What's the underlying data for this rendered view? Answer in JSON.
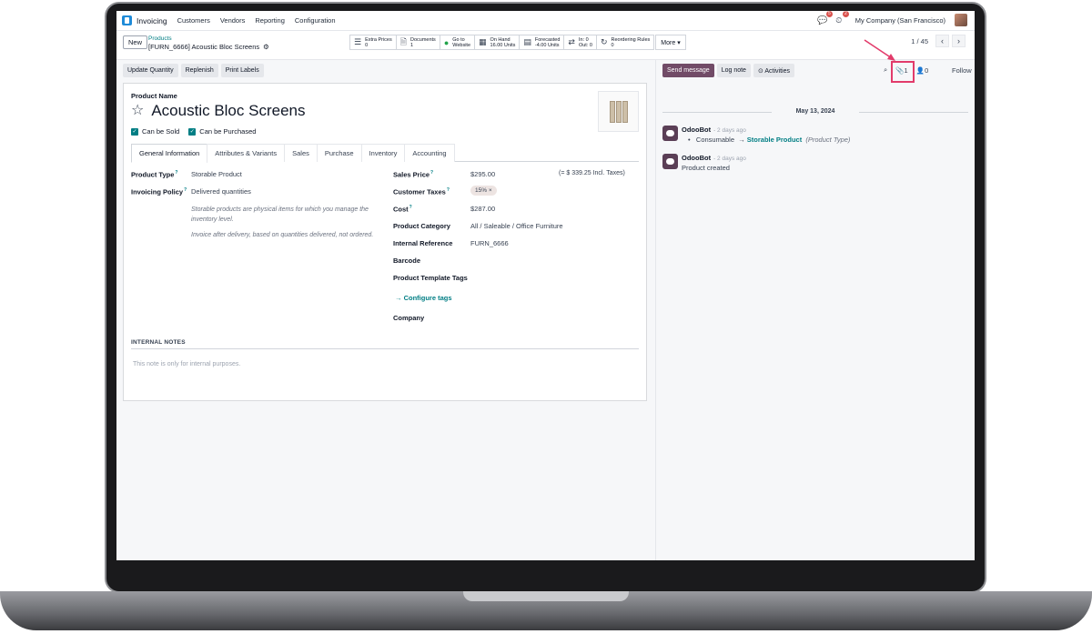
{
  "nav": {
    "app_name": "Invoicing",
    "menu": [
      "Customers",
      "Vendors",
      "Reporting",
      "Configuration"
    ],
    "chat_badge": "5",
    "activity_badge": "2",
    "company": "My Company (San Francisco)"
  },
  "control": {
    "new_label": "New",
    "breadcrumb": "Products",
    "record": "[FURN_6666] Acoustic Bloc Screens",
    "smart_buttons": [
      {
        "icon": "list-icon",
        "line1": "Extra Prices",
        "line2": "0"
      },
      {
        "icon": "document-icon",
        "line1": "Documents",
        "line2": "1"
      },
      {
        "icon": "globe-icon",
        "line1": "Go to",
        "line2": "Website"
      },
      {
        "icon": "cubes-icon",
        "line1": "On Hand",
        "line2": "16.00 Units"
      },
      {
        "icon": "chart-icon",
        "line1": "Forecasted",
        "line2": "-4.00 Units"
      },
      {
        "icon": "exchange-icon",
        "line1": "In: 0",
        "line2": "Out: 0"
      },
      {
        "icon": "refresh-icon",
        "line1": "Reordering Rules",
        "line2": "0"
      }
    ],
    "more_label": "More ▾",
    "pager": "1 / 45"
  },
  "actions": [
    "Update Quantity",
    "Replenish",
    "Print Labels"
  ],
  "form": {
    "product_name_label": "Product Name",
    "title": "Acoustic Bloc Screens",
    "can_be_sold": "Can be Sold",
    "can_be_purchased": "Can be Purchased",
    "tabs": [
      "General Information",
      "Attributes & Variants",
      "Sales",
      "Purchase",
      "Inventory",
      "Accounting"
    ],
    "left": {
      "product_type_label": "Product Type",
      "product_type": "Storable Product",
      "invoicing_policy_label": "Invoicing Policy",
      "invoicing_policy": "Delivered quantities",
      "help1": "Storable products are physical items for which you manage the inventory level.",
      "help2": "Invoice after delivery, based on quantities delivered, not ordered."
    },
    "right": {
      "sales_price_label": "Sales Price",
      "sales_price": "$295.00",
      "incl_taxes": "(= $ 339.25 Incl. Taxes)",
      "customer_taxes_label": "Customer Taxes",
      "customer_tax_tag": "15% ×",
      "cost_label": "Cost",
      "cost": "$287.00",
      "category_label": "Product Category",
      "category": "All / Saleable / Office Furniture",
      "internal_ref_label": "Internal Reference",
      "internal_ref": "FURN_6666",
      "barcode_label": "Barcode",
      "template_tags_label": "Product Template Tags",
      "configure_tags": "→  Configure tags",
      "company_label": "Company"
    },
    "notes_header": "INTERNAL NOTES",
    "notes_placeholder": "This note is only for internal purposes."
  },
  "chatter": {
    "send_message": "Send message",
    "log_note": "Log note",
    "activities": "⊙ Activities",
    "attachments_count": "1",
    "followers_count": "0",
    "follow": "Follow",
    "date": "May 13, 2024",
    "messages": [
      {
        "author": "OdooBot",
        "time": "- 2 days ago",
        "bullet": "•",
        "old": "Consumable",
        "arrow": "→",
        "new": "Storable Product",
        "field": "(Product Type)"
      },
      {
        "author": "OdooBot",
        "time": "- 2 days ago",
        "body": "Product created"
      }
    ]
  }
}
